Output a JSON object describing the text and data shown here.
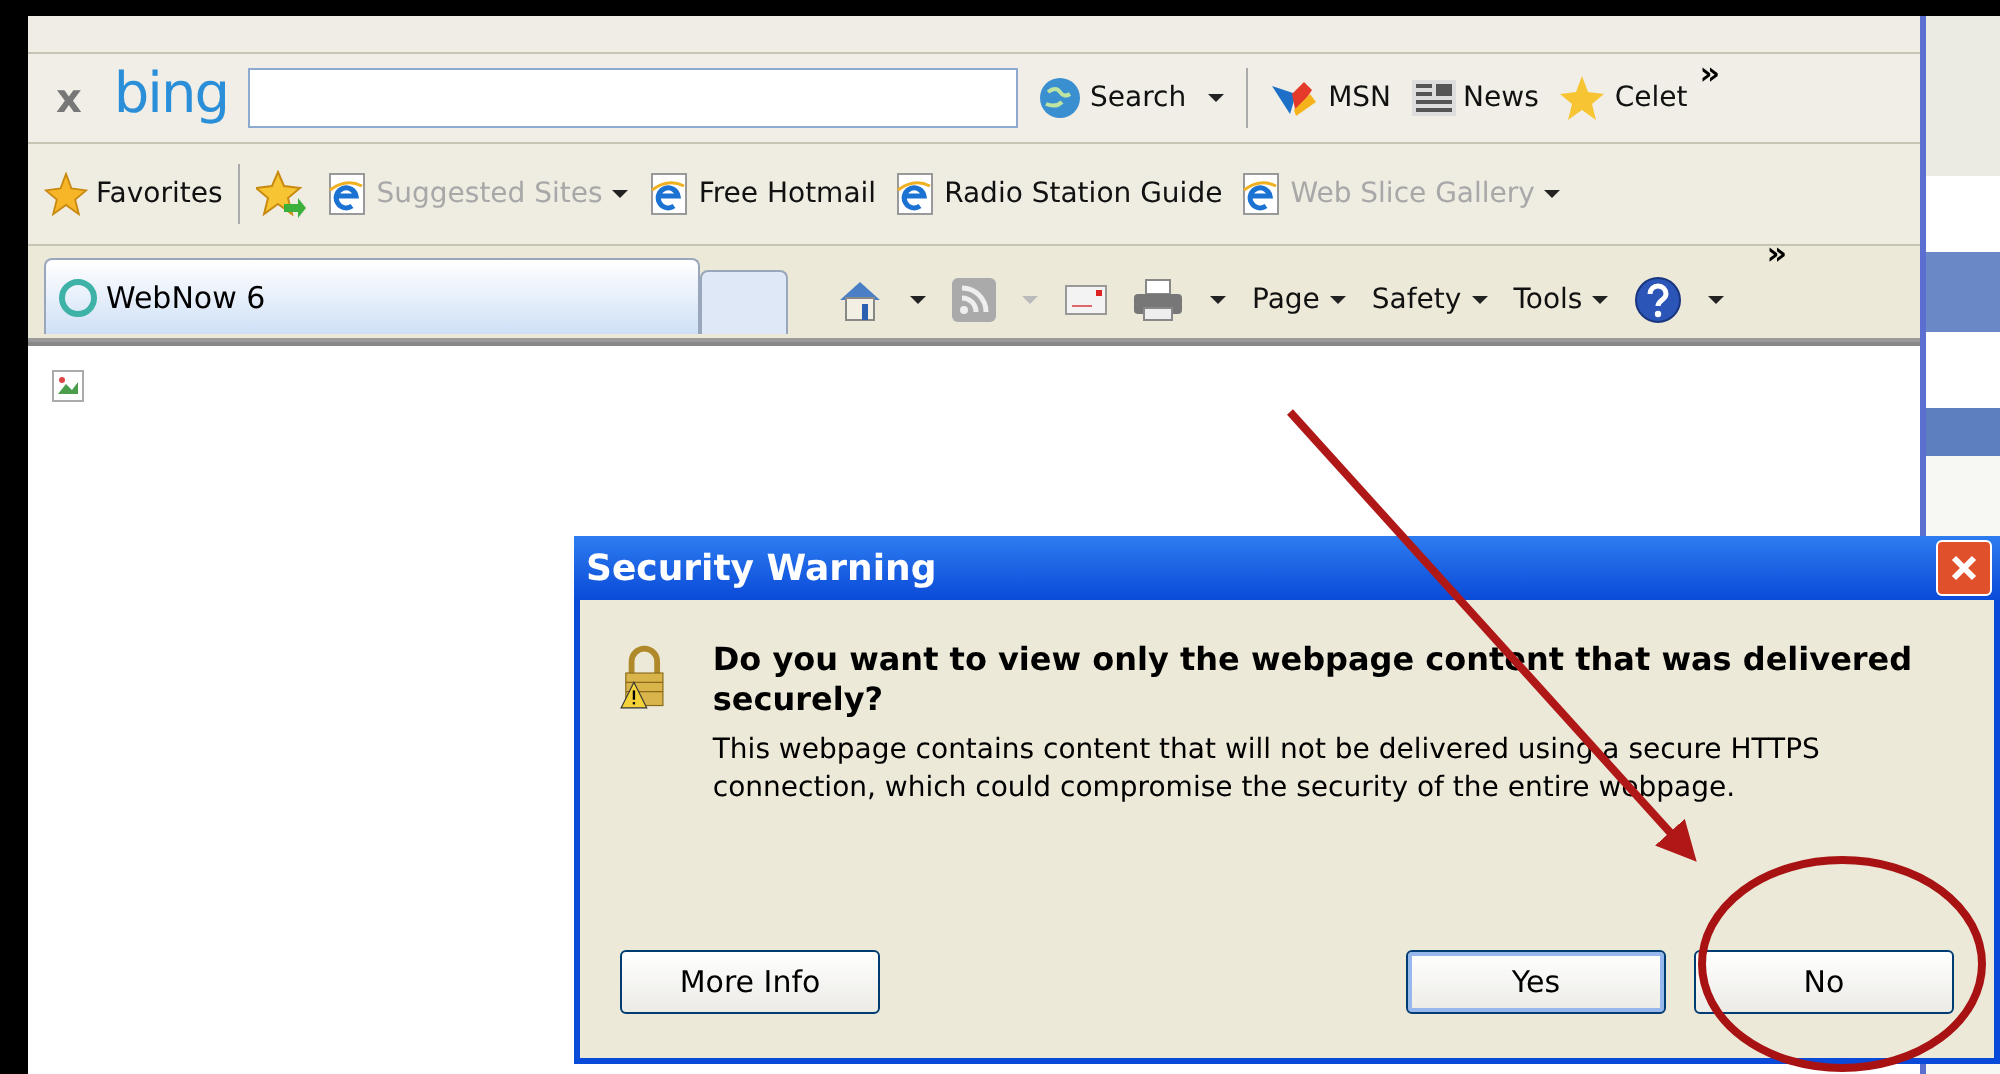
{
  "bing_bar": {
    "close": "x",
    "logo": "bing",
    "search_button": "Search",
    "links": [
      {
        "kind": "msn",
        "label": "MSN"
      },
      {
        "kind": "news",
        "label": "News"
      },
      {
        "kind": "star",
        "label": "Celet"
      }
    ],
    "overflow": "»"
  },
  "favorites_bar": {
    "favorites": "Favorites",
    "items": [
      {
        "label": "Suggested Sites",
        "disabled": true,
        "dropdown": true
      },
      {
        "label": "Free Hotmail",
        "disabled": false,
        "dropdown": false
      },
      {
        "label": "Radio Station Guide",
        "disabled": false,
        "dropdown": false
      },
      {
        "label": "Web Slice Gallery",
        "disabled": true,
        "dropdown": true
      }
    ]
  },
  "tabs": [
    {
      "label": "WebNow 6",
      "selected": true
    }
  ],
  "command_bar": {
    "menus": [
      {
        "label": "Page"
      },
      {
        "label": "Safety"
      },
      {
        "label": "Tools"
      }
    ],
    "overflow": "»"
  },
  "dialog": {
    "title": "Security Warning",
    "question": "Do you want to view only the webpage content that was delivered securely?",
    "message": "This webpage contains content that will not be delivered using a secure HTTPS connection, which could compromise the security of the entire webpage.",
    "buttons": [
      {
        "label": "More Info",
        "highlighted": false
      },
      {
        "label": "Yes",
        "highlighted": true
      },
      {
        "label": "No",
        "highlighted": false
      }
    ]
  }
}
